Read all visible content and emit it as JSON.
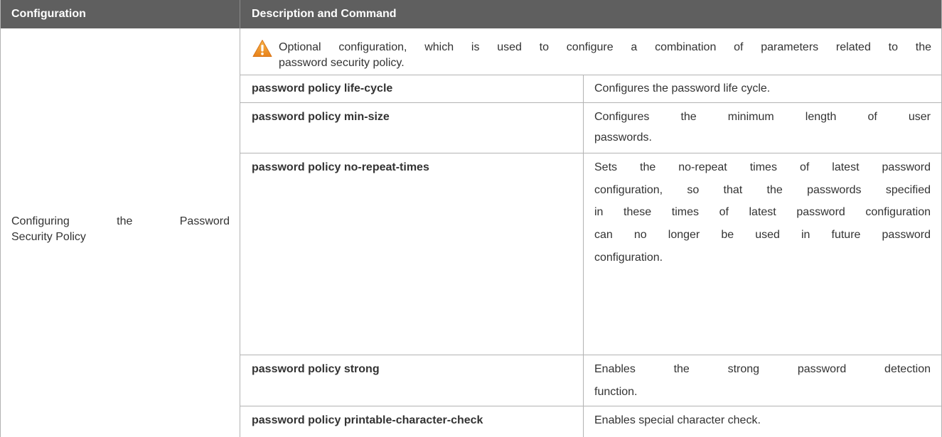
{
  "table": {
    "headers": [
      "Configuration",
      "Description and Command"
    ],
    "configuration": {
      "line1": "Configuring the Password",
      "line2": "Security Policy"
    },
    "note": {
      "icon": "warning-icon",
      "line1": "Optional configuration, which is used to configure a combination of parameters related to the",
      "line2": "password security policy."
    },
    "rows": [
      {
        "command": "password policy life-cycle",
        "description": [
          "Configures the password life cycle."
        ]
      },
      {
        "command": "password policy min-size",
        "description": [
          "Configures the minimum length of user",
          "passwords."
        ]
      },
      {
        "command": "password policy no-repeat-times",
        "description": [
          "Sets the no-repeat times of latest password",
          "configuration, so that the passwords specified",
          "in these times of latest password configuration",
          "can no longer be used in future password",
          "configuration."
        ]
      },
      {
        "command": "password policy strong",
        "description": [
          "Enables the strong password detection",
          "function."
        ]
      },
      {
        "command": "password policy printable-character-check",
        "description": [
          "Enables special character check."
        ]
      }
    ]
  },
  "colors": {
    "header_bg": "#5f5f5f",
    "header_text": "#ffffff",
    "border": "#b3b3b3",
    "body_text": "#333333",
    "warning_fill": "#f39a1e"
  }
}
